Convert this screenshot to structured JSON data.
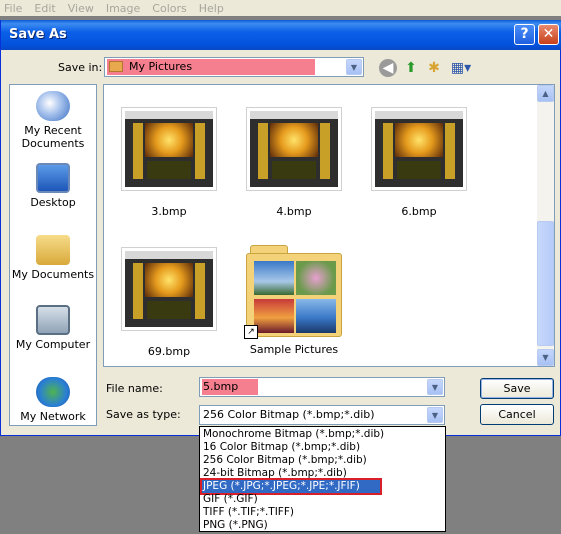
{
  "menu": [
    "File",
    "Edit",
    "View",
    "Image",
    "Colors",
    "Help"
  ],
  "dialog": {
    "title": "Save As",
    "help_label": "?",
    "close_label": "✕"
  },
  "save_in": {
    "label": "Save in:",
    "value": "My Pictures"
  },
  "places": [
    {
      "label": "My Recent Documents"
    },
    {
      "label": "Desktop"
    },
    {
      "label": "My Documents"
    },
    {
      "label": "My Computer"
    },
    {
      "label": "My Network"
    }
  ],
  "files": [
    {
      "name": "3.bmp"
    },
    {
      "name": "4.bmp"
    },
    {
      "name": "6.bmp"
    },
    {
      "name": "69.bmp"
    },
    {
      "name": "Sample Pictures"
    }
  ],
  "file_name": {
    "label": "File name:",
    "value": "5.bmp"
  },
  "save_as_type": {
    "label": "Save as type:",
    "value": "256 Color Bitmap (*.bmp;*.dib)",
    "options": [
      "Monochrome Bitmap (*.bmp;*.dib)",
      "16 Color Bitmap (*.bmp;*.dib)",
      "256 Color Bitmap (*.bmp;*.dib)",
      "24-bit Bitmap (*.bmp;*.dib)",
      "JPEG (*.JPG;*.JPEG;*.JPE;*.JFIF)",
      "GIF (*.GIF)",
      "TIFF (*.TIF;*.TIFF)",
      "PNG (*.PNG)"
    ],
    "highlighted_option": "JPEG (*.JPG;*.JPEG;*.JPE;*.JFIF)"
  },
  "buttons": {
    "save": "Save",
    "cancel": "Cancel"
  },
  "colors": {
    "title_bar": "#0b60e8",
    "dialog_bg": "#ece9d8",
    "redaction": "#f57f8f",
    "selection": "#316ac5",
    "highlight_box": "#d91f2a"
  }
}
